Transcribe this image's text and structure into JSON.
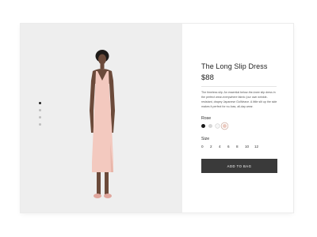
{
  "product": {
    "title": "The Long Slip Dress",
    "price": "$88",
    "description": "The timeless slip. An essential below-the-knee slip dress in the perfect wear-everywhere fabric (our own wrinkle-resistant, drapey Japanese GoWeave. A little slit up the side makes it perfect for no-fuss, all-day wear.",
    "color_label": "Rose",
    "colors": [
      {
        "name": "black",
        "hex": "#1a1a1a"
      },
      {
        "name": "grey",
        "hex": "#d7d7d7"
      },
      {
        "name": "white",
        "hex": "#f7f7f7"
      },
      {
        "name": "rose",
        "hex": "#eccabf"
      }
    ],
    "size_label": "Size",
    "sizes": [
      "0",
      "2",
      "4",
      "6",
      "8",
      "10",
      "12"
    ],
    "add_button": "ADD TO BAG"
  },
  "gallery": {
    "slide_count": 4,
    "active_index": 0
  },
  "colors": {
    "media_bg": "#eeeeee",
    "button_bg": "#3a3a3a",
    "dress": "#f3c9bf"
  }
}
